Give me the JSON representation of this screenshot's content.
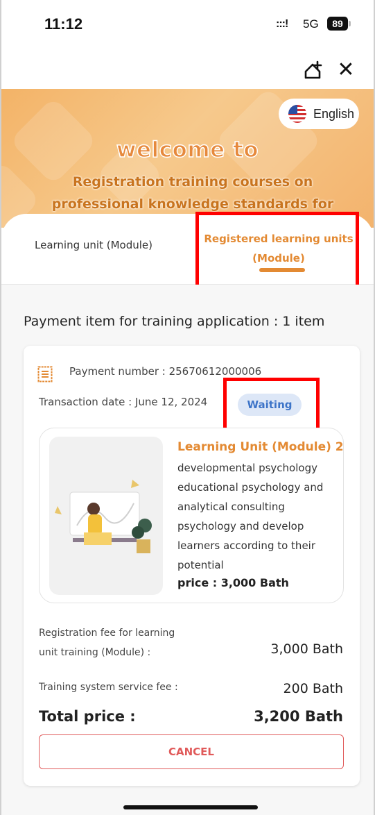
{
  "status_bar": {
    "time": "11:12",
    "signal": ":::!",
    "network": "5G",
    "battery": "89"
  },
  "header": {
    "language_label": "English"
  },
  "banner": {
    "welcome": "welcome to",
    "subtitle": "Registration training courses on professional knowledge standards for teachers"
  },
  "tabs": [
    {
      "label": "Learning unit (Module)",
      "active": false
    },
    {
      "label": "Registered learning units (Module)",
      "active": true
    }
  ],
  "section_title": "Payment item for training application : 1 item",
  "payment": {
    "number_text": "Payment number : 25670612000006",
    "date_text": "Transaction date : June 12, 2024",
    "status": "Waiting",
    "module": {
      "title": "Learning Unit (Module) 2",
      "description": "developmental psychology educational psychology and analytical consulting psychology and develop learners according to their potential",
      "price": "price : 3,000 Bath"
    },
    "fees": [
      {
        "label": "Registration fee for learning unit training (Module) :",
        "value": "3,000 Bath"
      },
      {
        "label": "Training system service fee :",
        "value": "200 Bath"
      }
    ],
    "total_label": "Total price :",
    "total_value": "3,200 Bath",
    "cancel_label": "CANCEL"
  },
  "colors": {
    "accent": "#e38a33",
    "banner": "#f3b367",
    "highlight": "#ff0000",
    "status_bg": "#dde7f7",
    "status_text": "#3d74c8",
    "cancel": "#e05a5a"
  },
  "icons": [
    "share-icon",
    "close-icon",
    "us-flag-icon",
    "document-icon",
    "illustration-icon"
  ]
}
